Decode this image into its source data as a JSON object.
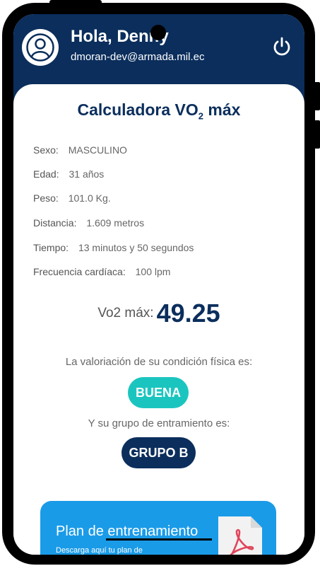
{
  "header": {
    "greeting": "Hola, Denny",
    "email": "dmoran-dev@armada.mil.ec"
  },
  "calculator": {
    "title_main": "Calculadora VO",
    "title_sub": "2",
    "title_end": " máx"
  },
  "fields": [
    {
      "label": "Sexo:",
      "value": "MASCULINO"
    },
    {
      "label": "Edad:",
      "value": "31 años"
    },
    {
      "label": "Peso:",
      "value": "101.0 Kg."
    },
    {
      "label": "Distancia:",
      "value": "1.609 metros"
    },
    {
      "label": "Tiempo:",
      "value": "13 minutos y 50 segundos"
    },
    {
      "label": "Frecuencia cardíaca:",
      "value": "100 lpm"
    }
  ],
  "result": {
    "label": "Vo2 máx:",
    "value": "49.25"
  },
  "assessment": {
    "prompt": "La valoriación de su condición física es:",
    "rating": "BUENA",
    "group_prompt": "Y su grupo de entramiento es:",
    "group": "GRUPO B"
  },
  "plan": {
    "title": "Plan de entrenamiento",
    "subtitle": "Descarga aquí tu plan de"
  },
  "colors": {
    "navy": "#0b2e5c",
    "teal": "#1bc5bf",
    "blue": "#1a9be8"
  },
  "icons": {
    "avatar": "user-avatar-icon",
    "power": "power-icon",
    "pdf": "pdf-file-icon"
  }
}
